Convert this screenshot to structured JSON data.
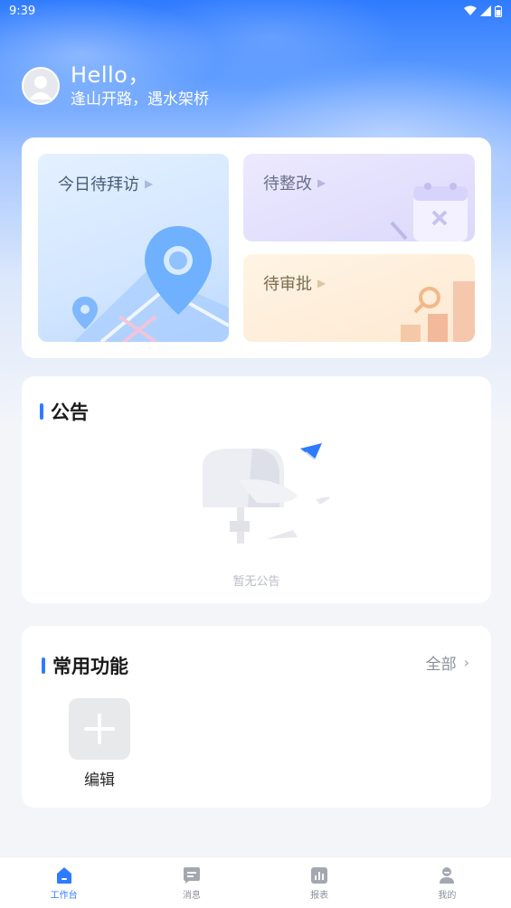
{
  "status_bar": {
    "time": "9:39"
  },
  "header": {
    "greeting": "Hello，",
    "motto": "逢山开路，遇水架桥"
  },
  "tasks": {
    "visit_label": "今日待拜访",
    "fix_label": "待整改",
    "approve_label": "待审批"
  },
  "notice": {
    "title": "公告",
    "empty_text": "暂无公告"
  },
  "functions": {
    "title": "常用功能",
    "all_label": "全部",
    "items": [
      {
        "label": "编辑",
        "icon": "plus-icon"
      }
    ]
  },
  "nav": {
    "items": [
      {
        "label": "工作台",
        "icon": "home-icon",
        "active": true
      },
      {
        "label": "消息",
        "icon": "message-icon",
        "active": false
      },
      {
        "label": "报表",
        "icon": "report-icon",
        "active": false
      },
      {
        "label": "我的",
        "icon": "profile-icon",
        "active": false
      }
    ]
  },
  "colors": {
    "accent": "#2f7bff",
    "page_bg": "#f3f5f9"
  }
}
